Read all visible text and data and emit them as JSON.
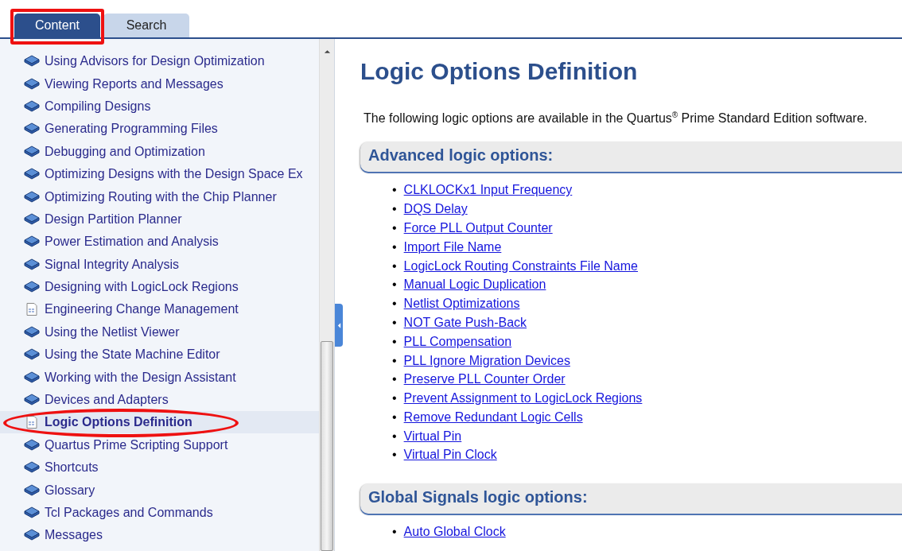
{
  "tabs": [
    {
      "label": "Content",
      "selected": true
    },
    {
      "label": "Search",
      "selected": false
    }
  ],
  "sidebar": {
    "items": [
      {
        "label": "Using Advisors for Design Optimization",
        "kind": "book",
        "selected": false
      },
      {
        "label": "Viewing Reports and Messages",
        "kind": "book",
        "selected": false
      },
      {
        "label": "Compiling Designs",
        "kind": "book",
        "selected": false
      },
      {
        "label": "Generating Programming Files",
        "kind": "book",
        "selected": false
      },
      {
        "label": "Debugging and Optimization",
        "kind": "book",
        "selected": false
      },
      {
        "label": "Optimizing Designs with the Design Space Ex",
        "kind": "book",
        "selected": false
      },
      {
        "label": "Optimizing Routing with the Chip Planner",
        "kind": "book",
        "selected": false
      },
      {
        "label": "Design Partition Planner",
        "kind": "book",
        "selected": false
      },
      {
        "label": "Power Estimation and Analysis",
        "kind": "book",
        "selected": false
      },
      {
        "label": "Signal Integrity Analysis",
        "kind": "book",
        "selected": false
      },
      {
        "label": "Designing with LogicLock Regions",
        "kind": "book",
        "selected": false
      },
      {
        "label": "Engineering Change Management",
        "kind": "page",
        "selected": false
      },
      {
        "label": "Using the Netlist Viewer",
        "kind": "book",
        "selected": false
      },
      {
        "label": "Using the State Machine Editor",
        "kind": "book",
        "selected": false
      },
      {
        "label": "Working with the Design Assistant",
        "kind": "book",
        "selected": false
      },
      {
        "label": "Devices and Adapters",
        "kind": "book",
        "selected": false
      },
      {
        "label": "Logic Options Definition",
        "kind": "page",
        "selected": true
      },
      {
        "label": "Quartus Prime Scripting Support",
        "kind": "book",
        "selected": false
      },
      {
        "label": "Shortcuts",
        "kind": "book",
        "selected": false
      },
      {
        "label": "Glossary",
        "kind": "book",
        "selected": false
      },
      {
        "label": "Tcl Packages and Commands",
        "kind": "book",
        "selected": false
      },
      {
        "label": "Messages",
        "kind": "book",
        "selected": false
      }
    ]
  },
  "content": {
    "title": "Logic Options Definition",
    "intro": "The following logic options are available in the Quartus$^{®}$ Prime Standard Edition software.",
    "sections": [
      {
        "heading": "Advanced logic options:",
        "marker": "•",
        "links": [
          "CLKLOCKx1 Input Frequency",
          "DQS Delay",
          "Force PLL Output Counter",
          "Import File Name",
          "LogicLock Routing Constraints File Name",
          "Manual Logic Duplication",
          "Netlist Optimizations",
          "NOT Gate Push-Back",
          "PLL Compensation",
          "PLL Ignore Migration Devices",
          "Preserve PLL Counter Order",
          "Prevent Assignment to LogicLock Regions",
          "Remove Redundant Logic Cells",
          "Virtual Pin",
          "Virtual Pin Clock"
        ]
      },
      {
        "heading": "Global Signals logic options:",
        "marker": "•",
        "links": [
          "Auto Global Clock"
        ]
      }
    ]
  }
}
